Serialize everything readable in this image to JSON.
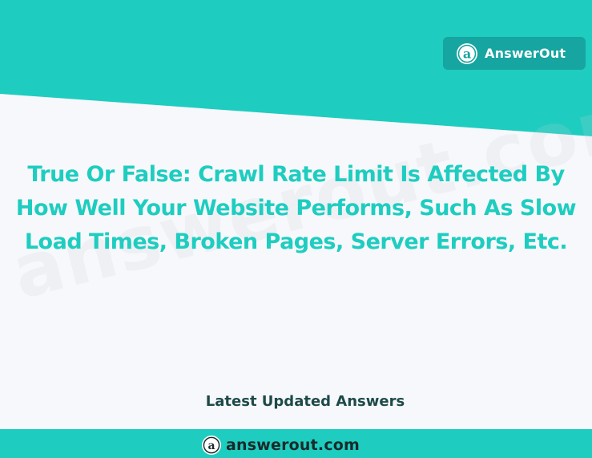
{
  "colors": {
    "teal": "#1ECDC0",
    "badge_teal": "#16A5A0",
    "headline": "#1ECDC0",
    "subheading": "#1D4A48",
    "background": "#F7F8FB"
  },
  "brand": {
    "badge_label": "AnswerOut",
    "icon": "answerout-a-logo-icon"
  },
  "question": {
    "title": "True Or False: Crawl Rate Limit Is Affected By How Well Your Website Performs, Such As Slow Load Times, Broken Pages, Server Errors, Etc."
  },
  "watermark": {
    "text": "answerout.com"
  },
  "section": {
    "subheading": "Latest Updated Answers"
  },
  "footer": {
    "domain": "answerout.com",
    "icon": "answerout-a-logo-icon"
  }
}
